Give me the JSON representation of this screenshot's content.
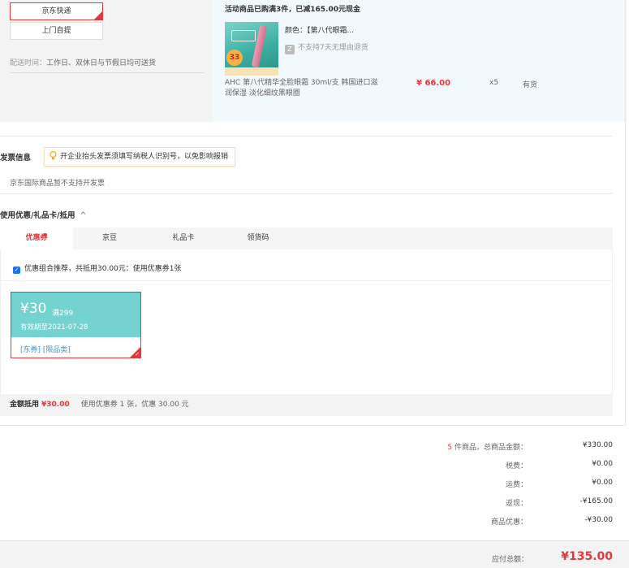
{
  "shipping": {
    "options": [
      "京东快递",
      "上门自提"
    ],
    "selected": "京东快递",
    "time_label": "配送时间：",
    "time_value": "工作日、双休日与节假日均可送货"
  },
  "product_block": {
    "promo": "活动商品已购满3件，已减165.00元现金",
    "color_label": "颜色：",
    "color_value": "【第八代眼霜...",
    "no_return": "不支持7天无理由退货",
    "no_return_icon": "Z",
    "image_badge": "33",
    "name": "AHC 第八代精华全脸眼霜 30ml/支 韩国进口滋润保湿 淡化细纹黑眼圈",
    "price": "¥ 66.00",
    "qty": "x5",
    "stock": "有货"
  },
  "invoice": {
    "title": "发票信息",
    "tip": "开企业抬头发票须填写纳税人识别号，以免影响报销",
    "note": "京东国际商品暂不支持开发票"
  },
  "coupons": {
    "title": "使用优惠/礼品卡/抵用",
    "tabs": [
      "优惠券",
      "京豆",
      "礼品卡",
      "领货码"
    ],
    "active_tab": "优惠券",
    "recommend": "优惠组合推荐，共抵用30.00元：使用优惠券1张",
    "card": {
      "amount": "¥30",
      "condition": "满299",
      "valid": "有效期至2021-07-28",
      "tags": "[东券] [限品类]"
    },
    "discount_label": "金额抵用",
    "discount_value": "¥30.00",
    "discount_detail": "使用优惠券 1 张，优惠 30.00 元"
  },
  "summary": {
    "count": "5",
    "count_label": " 件商品，总商品金额：",
    "goods_total": "¥330.00",
    "tax_label": "税费：",
    "tax": "¥0.00",
    "shipping_label": "运费：",
    "shipping": "¥0.00",
    "cashback_label": "返现：",
    "cashback": "-¥165.00",
    "product_discount_label": "商品优惠：",
    "product_discount": "-¥30.00",
    "payable_label": "应付总额：",
    "payable": "¥135.00"
  },
  "colors": {
    "accent": "#e4393c",
    "coupon_teal": "#74d2d0",
    "link_blue": "#4a90c8"
  }
}
